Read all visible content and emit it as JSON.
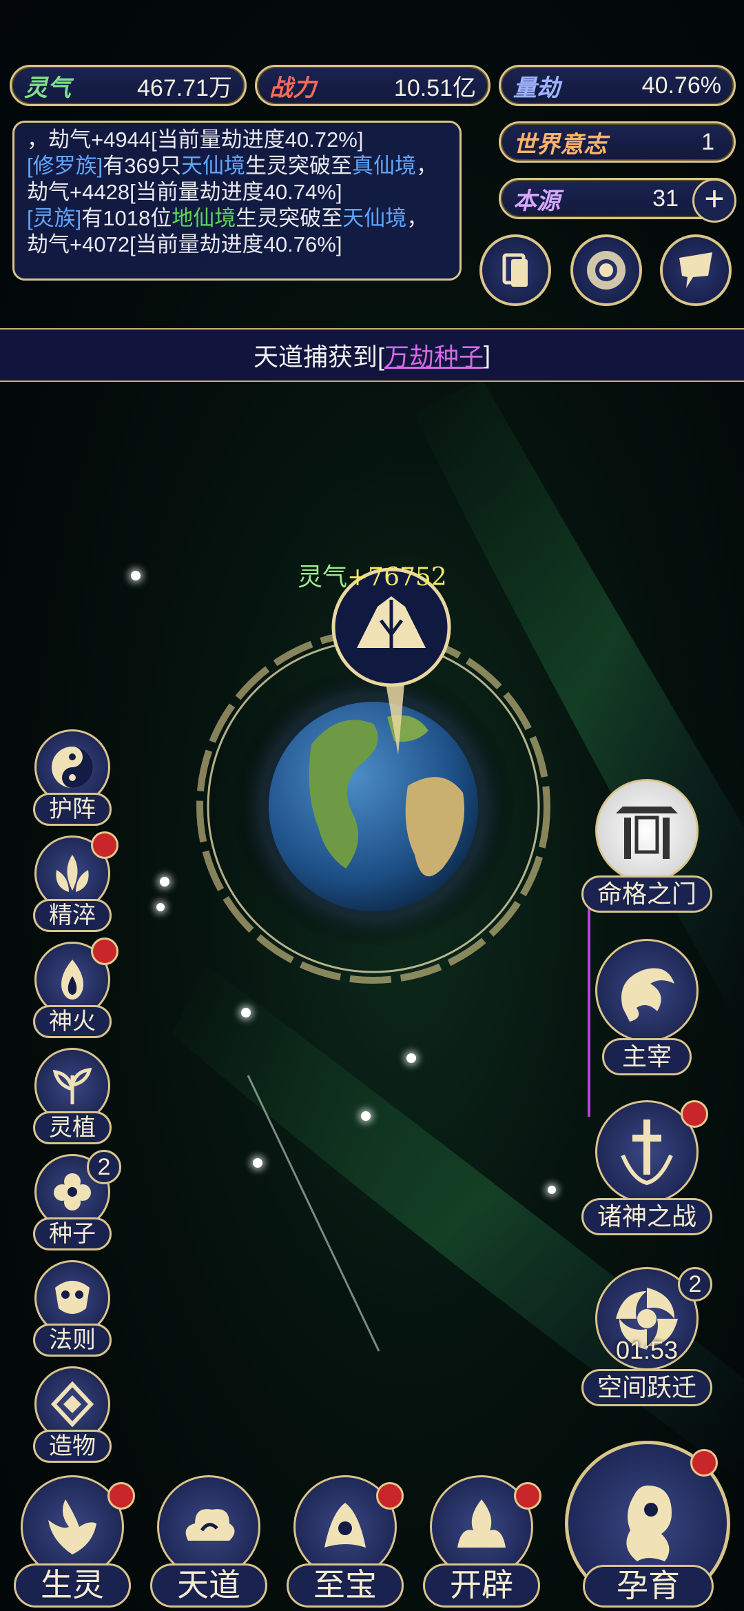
{
  "stats": {
    "lingqi": {
      "label": "灵气",
      "value": "467.71万",
      "color": "#7fe08a"
    },
    "zhanli": {
      "label": "战力",
      "value": "10.51亿",
      "color": "#ff6b5a"
    },
    "liangjie": {
      "label": "量劫",
      "value": "40.76%",
      "color": "#9fb4ff"
    },
    "world_will": {
      "label": "世界意志",
      "value": "1",
      "color": "#ffb36b"
    },
    "benyuan": {
      "label": "本源",
      "value": "31",
      "color": "#d7a7ff"
    }
  },
  "log": {
    "line1": "，劫气+4944[当前量劫进度40.72%]",
    "entry2_race": "[修罗族]",
    "entry2_a": "有369只",
    "entry2_realm1": "天仙境",
    "entry2_b": "生灵突破至",
    "entry2_realm2": "真仙境",
    "entry2_c": "，劫气+4428[当前量劫进度40.74%]",
    "entry3_race": "[灵族]",
    "entry3_a": "有1018位",
    "entry3_realm1": "地仙境",
    "entry3_b": "生灵突破至",
    "entry3_realm2": "天仙境",
    "entry3_c": "，劫气+4072[当前量劫进度40.76%]"
  },
  "banner": {
    "prefix": "天道捕获到[",
    "item": "万劫种子",
    "suffix": "]"
  },
  "float_text": {
    "label": "灵气",
    "value": "+76752"
  },
  "left_menu": [
    {
      "label": "护阵"
    },
    {
      "label": "精淬"
    },
    {
      "label": "神火"
    },
    {
      "label": "灵植"
    },
    {
      "label": "种子",
      "badge": "2"
    },
    {
      "label": "法则"
    },
    {
      "label": "造物"
    }
  ],
  "right_menu": {
    "gate": "命格之门",
    "master": "主宰",
    "war": "诸神之战",
    "leap": "空间跃迁",
    "leap_badge": "2",
    "leap_timer": "01:53"
  },
  "bottom_nav": [
    {
      "label": "生灵"
    },
    {
      "label": "天道"
    },
    {
      "label": "至宝"
    },
    {
      "label": "开辟"
    }
  ],
  "incubate": {
    "label": "孕育"
  }
}
